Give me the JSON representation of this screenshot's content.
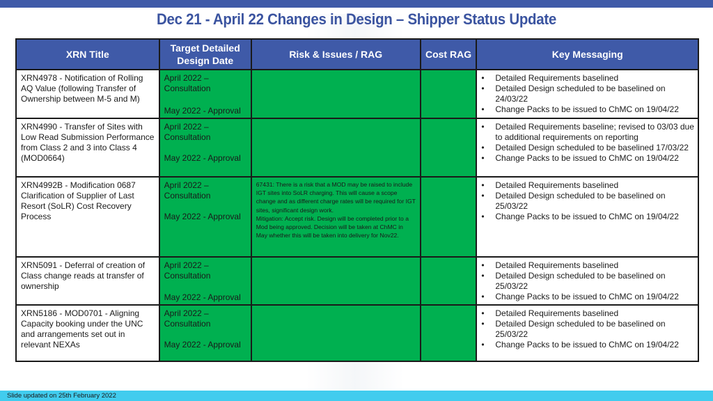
{
  "slide": {
    "title": "Dec 21 - April 22 Changes in Design – Shipper Status Update",
    "footer": "Slide updated on 25th February 2022",
    "colors": {
      "header_blue": "#3f5aa8",
      "title_blue": "#3b54a0",
      "rag_green": "#00b050",
      "footer_cyan": "#41ccee"
    }
  },
  "table": {
    "headers": {
      "xrn_title": "XRN Title",
      "target_date": "Target Detailed Design Date",
      "risk": "Risk & Issues / RAG",
      "cost": "Cost RAG",
      "key": "Key Messaging"
    },
    "rows": [
      {
        "title": "XRN4978 - Notification of Rolling AQ Value (following Transfer of Ownership between M-5 and M)",
        "date_consultation": "April 2022 – Consultation",
        "date_approval": "May 2022 - Approval",
        "risk_rag": "green",
        "risk_text": "",
        "cost_rag": "green",
        "key_messages": [
          "Detailed Requirements baselined",
          "Detailed Design scheduled to be baselined on 24/03/22",
          "Change Packs to be issued to ChMC on 19/04/22"
        ]
      },
      {
        "title": "XRN4990 - Transfer of Sites with Low Read Submission Performance from Class 2 and 3 into Class 4 (MOD0664)",
        "date_consultation": "April 2022 – Consultation",
        "date_approval": "May 2022 - Approval",
        "risk_rag": "green",
        "risk_text": "",
        "cost_rag": "green",
        "key_messages": [
          "Detailed Requirements baseline; revised to 03/03 due to additional requirements on reporting",
          "Detailed Design scheduled to be baselined 17/03/22",
          "Change Packs to be issued to ChMC on 19/04/22"
        ]
      },
      {
        "title": "XRN4992B - Modification 0687 Clarification of Supplier of Last Resort (SoLR) Cost Recovery Process",
        "date_consultation": "April 2022 – Consultation",
        "date_approval": "May 2022 - Approval",
        "risk_rag": "green",
        "risk_text": "67431: There is a risk that a MOD may be raised to include IGT sites into SoLR charging. This will cause a scope change and as different charge rates will be required for IGT sites, significant design work.",
        "risk_mitigation": "Mitigation: Accept risk. Design will be completed prior to a Mod being approved. Decision will be taken at ChMC in May whether this will be taken into delivery for Nov22.",
        "cost_rag": "green",
        "key_messages": [
          "Detailed Requirements baselined",
          "Detailed Design scheduled to be baselined on 25/03/22",
          "Change Packs to be issued to ChMC on 19/04/22"
        ]
      },
      {
        "title": "XRN5091 - Deferral of creation of Class change reads at transfer of ownership",
        "date_consultation": "April 2022 – Consultation",
        "date_approval": "May 2022 - Approval",
        "risk_rag": "green",
        "risk_text": "",
        "cost_rag": "green",
        "key_messages": [
          "Detailed Requirements baselined",
          "Detailed Design scheduled to be baselined on 25/03/22",
          "Change Packs to be issued to ChMC on 19/04/22"
        ]
      },
      {
        "title": "XRN5186 - MOD0701 - Aligning Capacity booking under the UNC and arrangements set out in relevant NEXAs",
        "date_consultation": "April 2022 – Consultation",
        "date_approval": "May 2022 - Approval",
        "risk_rag": "green",
        "risk_text": "",
        "cost_rag": "green",
        "key_messages": [
          "Detailed Requirements baselined",
          "Detailed Design scheduled to be baselined on 25/03/22",
          "Change Packs to be issued to ChMC on 19/04/22"
        ]
      }
    ]
  }
}
